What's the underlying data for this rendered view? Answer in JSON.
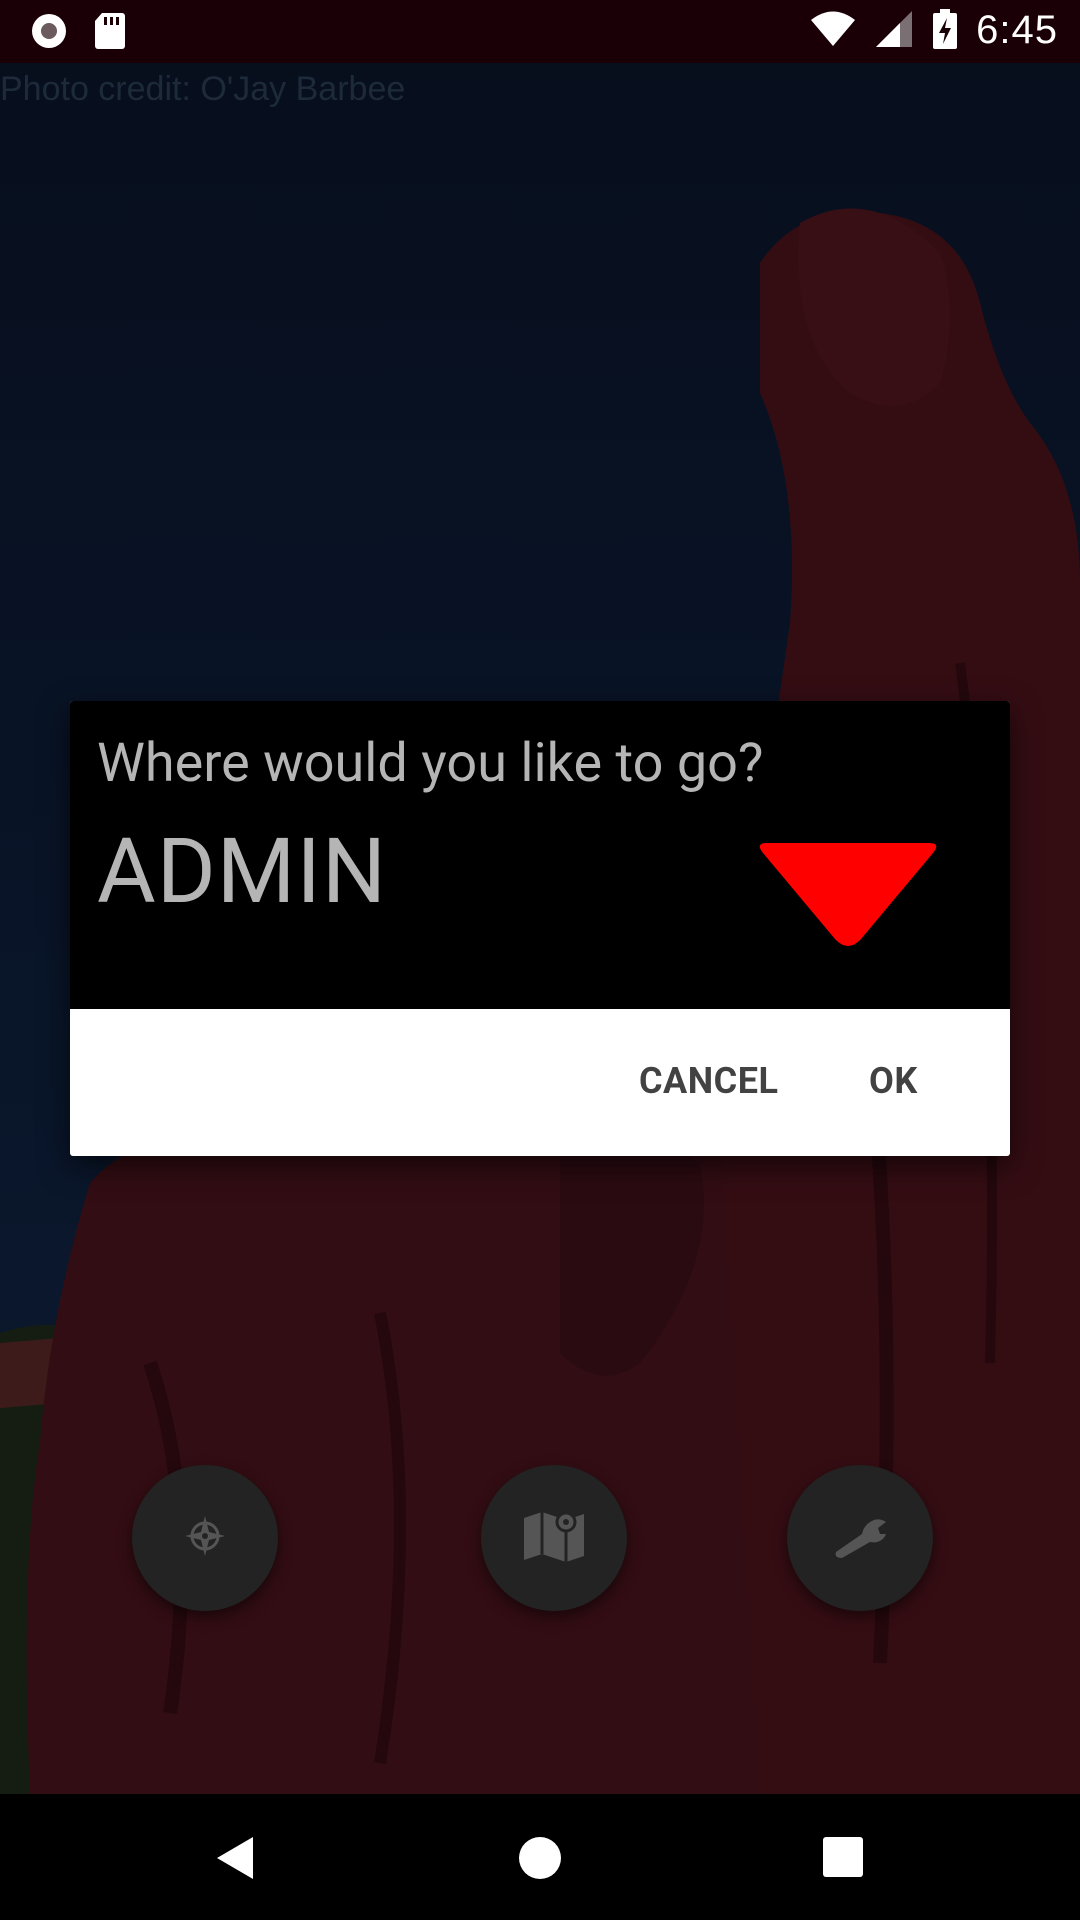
{
  "status_bar": {
    "time": "6:45",
    "icons": [
      "record-icon",
      "sd-card-icon",
      "wifi-icon",
      "signal-icon",
      "battery-charging-icon"
    ]
  },
  "background": {
    "photo_credit": "Photo credit: O'Jay Barbee"
  },
  "dialog": {
    "question": "Where would you like to go?",
    "selected_value": "ADMIN",
    "cancel_label": "CANCEL",
    "ok_label": "OK",
    "dropdown_arrow_color": "#ff0000"
  },
  "fabs": [
    {
      "icon": "compass-icon"
    },
    {
      "icon": "map-icon"
    },
    {
      "icon": "wrench-icon"
    }
  ],
  "nav_bar": {
    "icons": [
      "back-icon",
      "home-icon",
      "recents-icon"
    ]
  }
}
